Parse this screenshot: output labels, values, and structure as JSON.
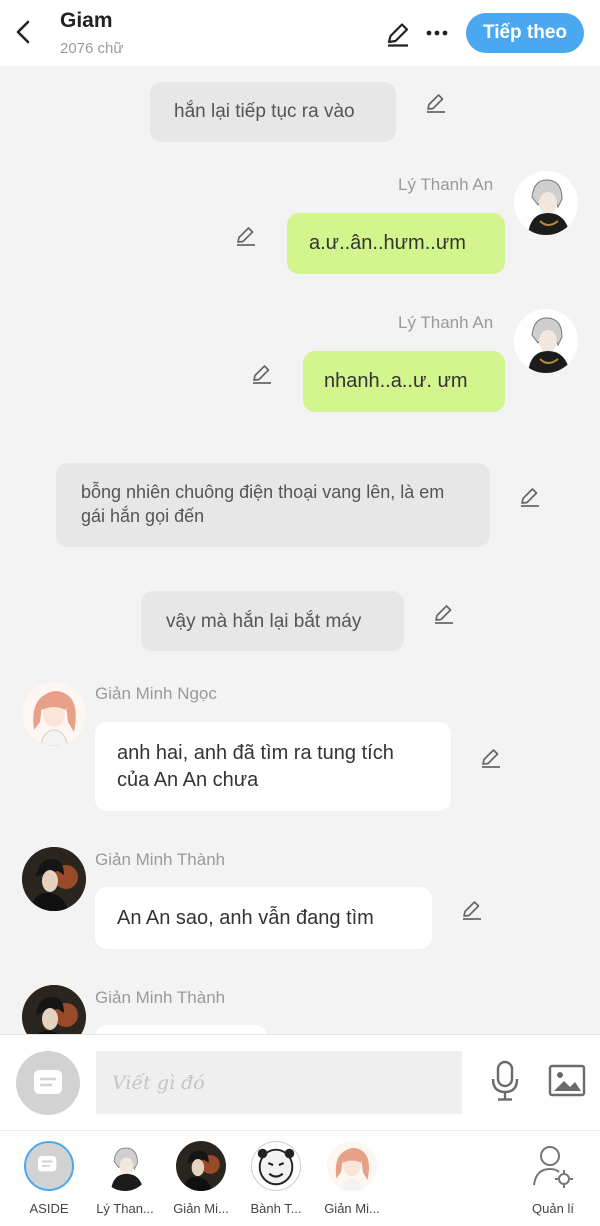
{
  "header": {
    "title": "Giam",
    "word_count": "2076 chữ",
    "next_label": "Tiếp theo",
    "accent": "#4aa8f0"
  },
  "messages": [
    {
      "type": "narration",
      "text": "hắn lại tiếp tục ra vào"
    },
    {
      "type": "right",
      "sender": "Lý Thanh An",
      "text": "a.ư..ân..hưm..ưm",
      "bubble_color": "#d3f58e"
    },
    {
      "type": "right",
      "sender": "Lý Thanh An",
      "text": "nhanh..a..ư. ưm",
      "bubble_color": "#d3f58e"
    },
    {
      "type": "narration",
      "text": "bỗng nhiên chuông điện thoại vang lên, là em gái hắn gọi đến"
    },
    {
      "type": "narration",
      "text": "vậy mà hắn lại bắt máy"
    },
    {
      "type": "left",
      "sender": "Giản Minh Ngọc",
      "text": "anh hai, anh đã tìm ra tung tích của An An chưa"
    },
    {
      "type": "left",
      "sender": "Giản Minh Thành",
      "text": "An An sao, anh vẫn đang tìm"
    },
    {
      "type": "left",
      "sender": "Giản Minh Thành",
      "text": ""
    }
  ],
  "input": {
    "placeholder": "Viết gì đó",
    "value": ""
  },
  "characters": [
    {
      "label": "ASIDE",
      "icon": "aside-icon"
    },
    {
      "label": "Lý Than...",
      "icon": "avatar-ly-thanh-an"
    },
    {
      "label": "Giản Mi...",
      "icon": "avatar-gian-minh-thanh"
    },
    {
      "label": "Bành T...",
      "icon": "avatar-meme-face"
    },
    {
      "label": "Giản Mi...",
      "icon": "avatar-gian-minh-ngoc"
    },
    {
      "label": "Quản lí",
      "icon": "manage-user-icon"
    }
  ]
}
